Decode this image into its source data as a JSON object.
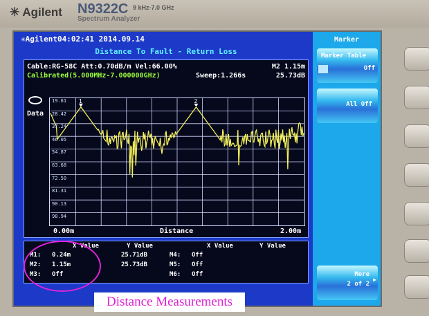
{
  "device": {
    "brand": "Agilent",
    "model": "N9322C",
    "range": "9 kHz-7.0 GHz",
    "subtitle": "Spectrum Analyzer"
  },
  "header": {
    "status": "Agilent04:02:41 2014.09.14",
    "title": "Distance To Fault - Return Loss"
  },
  "info": {
    "cable": "Cable:RG-58C Att:0.70dB/m Vel:66.00%",
    "calibration": "Calibrated(5.000MHz-7.000000GHz)",
    "sweep": "Sweep:1.266s",
    "active_marker": "M2 1.15m",
    "active_value": "25.73dB",
    "trace_label": "Data"
  },
  "chart_data": {
    "type": "line",
    "xlabel": "Distance",
    "x_start_label": "0.00m",
    "x_end_label": "2.00m",
    "xlim": [
      0,
      2
    ],
    "ylim": [
      19.61,
      107.75
    ],
    "y_inverted": true,
    "y_ticks": [
      "19.61",
      "28.42",
      "37.24",
      "46.05",
      "54.87",
      "63.68",
      "72.50",
      "81.31",
      "90.13",
      "98.94"
    ],
    "markers": [
      {
        "id": "1",
        "x": 0.24,
        "y": 25.71
      },
      {
        "id": "2",
        "x": 1.15,
        "y": 25.73
      }
    ],
    "trace_color": "#f4f05a"
  },
  "marker_table": {
    "headers": [
      "X Value",
      "Y Value",
      "X Value",
      "Y Value"
    ],
    "left": [
      {
        "m": "M1:",
        "x": "0.24m",
        "y": "25.71dB"
      },
      {
        "m": "M2:",
        "x": "1.15m",
        "y": "25.73dB"
      },
      {
        "m": "M3:",
        "x": "Off",
        "y": ""
      }
    ],
    "right": [
      {
        "m": "M4:",
        "x": "Off"
      },
      {
        "m": "M5:",
        "x": "Off"
      },
      {
        "m": "M6:",
        "x": "Off"
      }
    ]
  },
  "softkeys": {
    "title": "Marker",
    "marker_table": "Marker Table",
    "marker_table_state": "Off",
    "all_off": "All Off",
    "more": "More",
    "more_page": "2 of 2"
  },
  "annotation": "Distance Measurements"
}
